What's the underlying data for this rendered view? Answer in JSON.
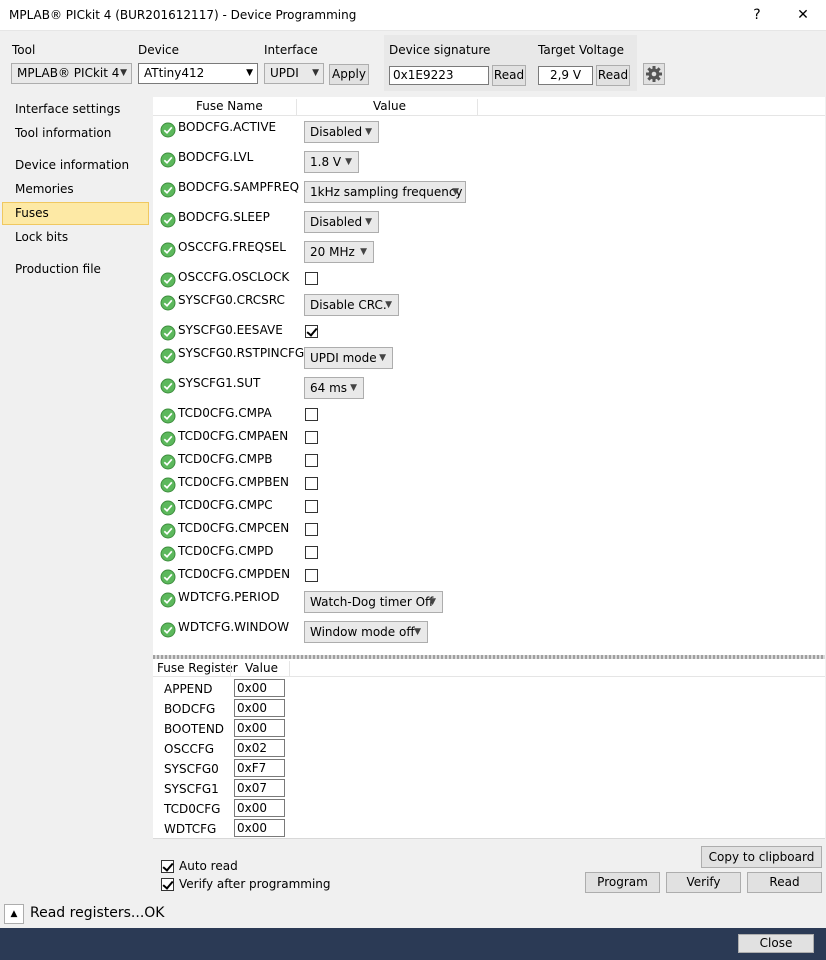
{
  "window": {
    "title": "MPLAB® PICkit 4 (BUR201612117) - Device Programming",
    "help_label": "?",
    "close_label": "✕"
  },
  "toolbar": {
    "tool_label": "Tool",
    "tool_value": "MPLAB® PICkit 4",
    "device_label": "Device",
    "device_value": "ATtiny412",
    "interface_label": "Interface",
    "interface_value": "UPDI",
    "apply_label": "Apply",
    "signature_label": "Device signature",
    "signature_value": "0x1E9223",
    "signature_read_label": "Read",
    "voltage_label": "Target Voltage",
    "voltage_value": "2,9 V",
    "voltage_read_label": "Read",
    "settings_icon": "gear-icon"
  },
  "sidebar": {
    "items": [
      {
        "label": "Interface settings",
        "active": false
      },
      {
        "label": "Tool information",
        "active": false
      },
      {
        "label": "Device information",
        "active": false
      },
      {
        "label": "Memories",
        "active": false
      },
      {
        "label": "Fuses",
        "active": true
      },
      {
        "label": "Lock bits",
        "active": false
      },
      {
        "label": "Production file",
        "active": false
      }
    ]
  },
  "fuse_grid": {
    "col_name": "Fuse Name",
    "col_value": "Value",
    "rows": [
      {
        "name": "BODCFG.ACTIVE",
        "kind": "select",
        "value": "Disabled"
      },
      {
        "name": "BODCFG.LVL",
        "kind": "select",
        "value": "1.8 V"
      },
      {
        "name": "BODCFG.SAMPFREQ",
        "kind": "select",
        "value": "1kHz sampling frequency"
      },
      {
        "name": "BODCFG.SLEEP",
        "kind": "select",
        "value": "Disabled"
      },
      {
        "name": "OSCCFG.FREQSEL",
        "kind": "select",
        "value": "20 MHz"
      },
      {
        "name": "OSCCFG.OSCLOCK",
        "kind": "checkbox",
        "checked": false
      },
      {
        "name": "SYSCFG0.CRCSRC",
        "kind": "select",
        "value": "Disable CRC."
      },
      {
        "name": "SYSCFG0.EESAVE",
        "kind": "checkbox",
        "checked": true
      },
      {
        "name": "SYSCFG0.RSTPINCFG",
        "kind": "select",
        "value": "UPDI mode"
      },
      {
        "name": "SYSCFG1.SUT",
        "kind": "select",
        "value": "64 ms"
      },
      {
        "name": "TCD0CFG.CMPA",
        "kind": "checkbox",
        "checked": false
      },
      {
        "name": "TCD0CFG.CMPAEN",
        "kind": "checkbox",
        "checked": false
      },
      {
        "name": "TCD0CFG.CMPB",
        "kind": "checkbox",
        "checked": false
      },
      {
        "name": "TCD0CFG.CMPBEN",
        "kind": "checkbox",
        "checked": false
      },
      {
        "name": "TCD0CFG.CMPC",
        "kind": "checkbox",
        "checked": false
      },
      {
        "name": "TCD0CFG.CMPCEN",
        "kind": "checkbox",
        "checked": false
      },
      {
        "name": "TCD0CFG.CMPD",
        "kind": "checkbox",
        "checked": false
      },
      {
        "name": "TCD0CFG.CMPDEN",
        "kind": "checkbox",
        "checked": false
      },
      {
        "name": "WDTCFG.PERIOD",
        "kind": "select",
        "value": "Watch-Dog timer Off"
      },
      {
        "name": "WDTCFG.WINDOW",
        "kind": "select",
        "value": "Window mode off"
      }
    ]
  },
  "register_grid": {
    "col_name": "Fuse Register",
    "col_value": "Value",
    "rows": [
      {
        "name": "APPEND",
        "value": "0x00"
      },
      {
        "name": "BODCFG",
        "value": "0x00"
      },
      {
        "name": "BOOTEND",
        "value": "0x00"
      },
      {
        "name": "OSCCFG",
        "value": "0x02"
      },
      {
        "name": "SYSCFG0",
        "value": "0xF7"
      },
      {
        "name": "SYSCFG1",
        "value": "0x07"
      },
      {
        "name": "TCD0CFG",
        "value": "0x00"
      },
      {
        "name": "WDTCFG",
        "value": "0x00"
      }
    ]
  },
  "actions": {
    "auto_read_label": "Auto read",
    "auto_read_checked": true,
    "verify_label": "Verify after programming",
    "verify_checked": true,
    "copy_label": "Copy to clipboard",
    "program_label": "Program",
    "verify_button_label": "Verify",
    "read_label": "Read"
  },
  "status": {
    "text": "Read registers...OK",
    "expander_icon": "triangle-up-icon"
  },
  "footer": {
    "close_label": "Close"
  },
  "colors": {
    "accent_selected": "#fde9a5",
    "check_green": "#5cb85c",
    "footer_bg": "#2b3a55"
  }
}
